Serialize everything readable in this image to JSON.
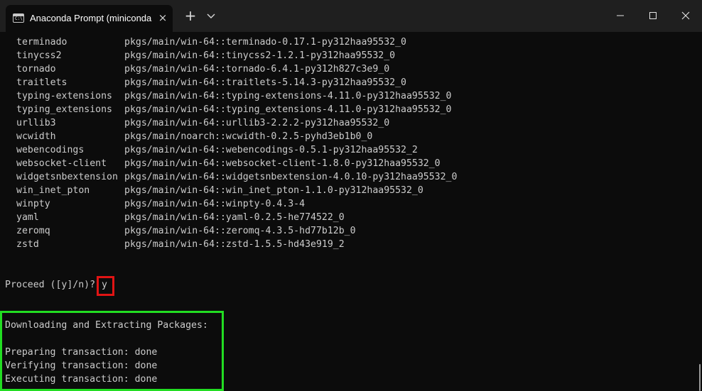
{
  "window": {
    "tab_title": "Anaconda Prompt (miniconda",
    "tab_icon_text": "C:\\",
    "new_tab_label": "+",
    "close_tab_label": "×"
  },
  "packages": [
    {
      "name": "terminado",
      "source": "pkgs/main/win-64::terminado-0.17.1-py312haa95532_0"
    },
    {
      "name": "tinycss2",
      "source": "pkgs/main/win-64::tinycss2-1.2.1-py312haa95532_0"
    },
    {
      "name": "tornado",
      "source": "pkgs/main/win-64::tornado-6.4.1-py312h827c3e9_0"
    },
    {
      "name": "traitlets",
      "source": "pkgs/main/win-64::traitlets-5.14.3-py312haa95532_0"
    },
    {
      "name": "typing-extensions",
      "source": "pkgs/main/win-64::typing-extensions-4.11.0-py312haa95532_0"
    },
    {
      "name": "typing_extensions",
      "source": "pkgs/main/win-64::typing_extensions-4.11.0-py312haa95532_0"
    },
    {
      "name": "urllib3",
      "source": "pkgs/main/win-64::urllib3-2.2.2-py312haa95532_0"
    },
    {
      "name": "wcwidth",
      "source": "pkgs/main/noarch::wcwidth-0.2.5-pyhd3eb1b0_0"
    },
    {
      "name": "webencodings",
      "source": "pkgs/main/win-64::webencodings-0.5.1-py312haa95532_2"
    },
    {
      "name": "websocket-client",
      "source": "pkgs/main/win-64::websocket-client-1.8.0-py312haa95532_0"
    },
    {
      "name": "widgetsnbextension",
      "source": "pkgs/main/win-64::widgetsnbextension-4.0.10-py312haa95532_0"
    },
    {
      "name": "win_inet_pton",
      "source": "pkgs/main/win-64::win_inet_pton-1.1.0-py312haa95532_0"
    },
    {
      "name": "winpty",
      "source": "pkgs/main/win-64::winpty-0.4.3-4"
    },
    {
      "name": "yaml",
      "source": "pkgs/main/win-64::yaml-0.2.5-he774522_0"
    },
    {
      "name": "zeromq",
      "source": "pkgs/main/win-64::zeromq-4.3.5-hd77b12b_0"
    },
    {
      "name": "zstd",
      "source": "pkgs/main/win-64::zstd-1.5.5-hd43e919_2"
    }
  ],
  "prompt": {
    "question": "Proceed ([y]/n)? ",
    "answer": "y"
  },
  "output": {
    "downloading": "Downloading and Extracting Packages:",
    "preparing": "Preparing transaction: done",
    "verifying": "Verifying transaction: done",
    "executing": "Executing transaction: done"
  },
  "colors": {
    "terminal_background": "#0c0c0c",
    "titlebar_background": "#1f1f1f",
    "text": "#cccccc",
    "highlight_red": "#e11414",
    "highlight_green": "#22dd22"
  },
  "icons": {
    "tab": "terminal-icon",
    "close_tab": "close-icon",
    "new_tab": "plus-icon",
    "dropdown": "chevron-down-icon",
    "minimize": "minimize-icon",
    "maximize": "maximize-icon",
    "close_window": "close-icon"
  }
}
